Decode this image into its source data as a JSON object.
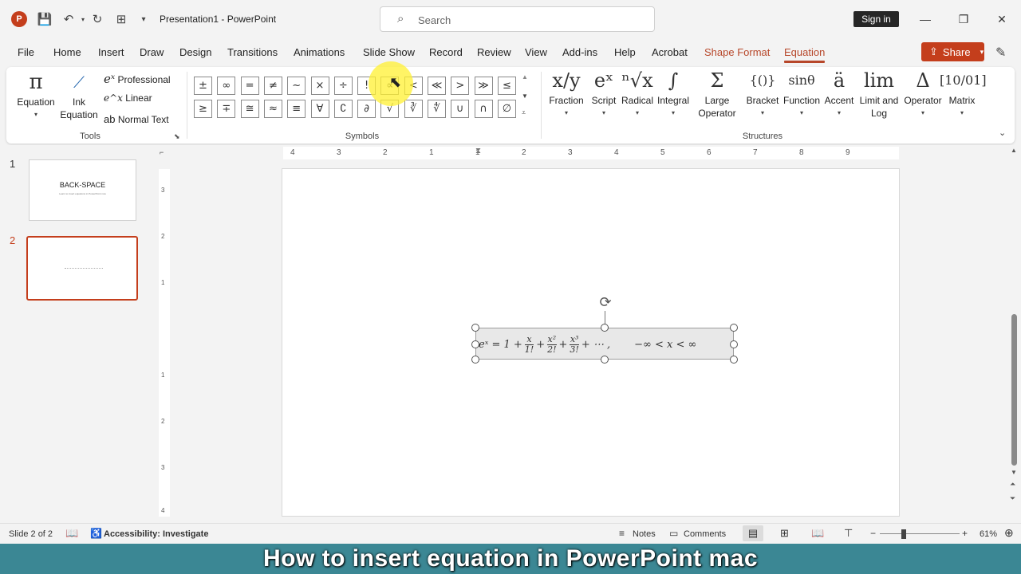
{
  "titlebar": {
    "doc_title": "Presentation1  -  PowerPoint",
    "search_placeholder": "Search",
    "sign_in": "Sign in",
    "app_logo": "P"
  },
  "tabs": [
    "File",
    "Home",
    "Insert",
    "Draw",
    "Design",
    "Transitions",
    "Animations",
    "Slide Show",
    "Record",
    "Review",
    "View",
    "Add-ins",
    "Help",
    "Acrobat",
    "Shape Format",
    "Equation"
  ],
  "share_label": "Share",
  "ribbon": {
    "tools": {
      "equation": "Equation",
      "ink_equation_1": "Ink",
      "ink_equation_2": "Equation",
      "professional": "Professional",
      "linear": "Linear",
      "normal_text": "Normal Text",
      "group_label": "Tools"
    },
    "symbols_row1": [
      "±",
      "∞",
      "=",
      "≠",
      "~",
      "×",
      "÷",
      "!",
      "∝",
      "<",
      "≪",
      ">",
      "≫",
      "≤"
    ],
    "symbols_row2": [
      "≥",
      "∓",
      "≅",
      "≈",
      "≡",
      "∀",
      "∁",
      "∂",
      "√",
      "∛",
      "∜",
      "∪",
      "∩",
      "∅"
    ],
    "symbols_label": "Symbols",
    "structures": [
      {
        "glyph": "x/y",
        "label": "Fraction",
        "label2": ""
      },
      {
        "glyph": "eˣ",
        "label": "Script",
        "label2": ""
      },
      {
        "glyph": "ⁿ√x",
        "label": "Radical",
        "label2": ""
      },
      {
        "glyph": "∫",
        "label": "Integral",
        "label2": ""
      },
      {
        "glyph": "Σ",
        "label": "Large",
        "label2": "Operator"
      },
      {
        "glyph": "{()}",
        "label": "Bracket",
        "label2": ""
      },
      {
        "glyph": "sinθ",
        "label": "Function",
        "label2": ""
      },
      {
        "glyph": "ä",
        "label": "Accent",
        "label2": ""
      },
      {
        "glyph": "lim",
        "label": "Limit and",
        "label2": "Log"
      },
      {
        "glyph": "Δ",
        "label": "Operator",
        "label2": ""
      },
      {
        "glyph": "[10/01]",
        "label": "Matrix",
        "label2": ""
      }
    ],
    "structures_label": "Structures"
  },
  "ruler": {
    "h_ticks": [
      "4",
      "3",
      "2",
      "1",
      "1",
      "2",
      "3",
      "4",
      "5",
      "6",
      "7",
      "8",
      "9"
    ],
    "v_ticks": [
      "3",
      "2",
      "1",
      "1",
      "2",
      "3",
      "4"
    ]
  },
  "thumbnails": [
    {
      "num": "1",
      "title": "BACK-SPACE",
      "sub": "Learn to insert equations in PowerPoint now"
    },
    {
      "num": "2",
      "title": "",
      "sub": ""
    }
  ],
  "equation": {
    "lhs": "eˣ = 1 +",
    "t1_num": "x",
    "t1_den": "1!",
    "t2_num": "x²",
    "t2_den": "2!",
    "t3_num": "x³",
    "t3_den": "3!",
    "tail": "+ ⋯ ,",
    "range": "−∞ < x < ∞"
  },
  "status": {
    "slide": "Slide 2 of 2",
    "accessibility": "Accessibility: Investigate",
    "notes": "Notes",
    "comments": "Comments",
    "zoom": "61%"
  },
  "caption": "How to insert equation in PowerPoint mac",
  "colors": {
    "accent": "#c43e1c",
    "tab_contextual": "#b7472a",
    "caption_bg": "#3b8794"
  }
}
